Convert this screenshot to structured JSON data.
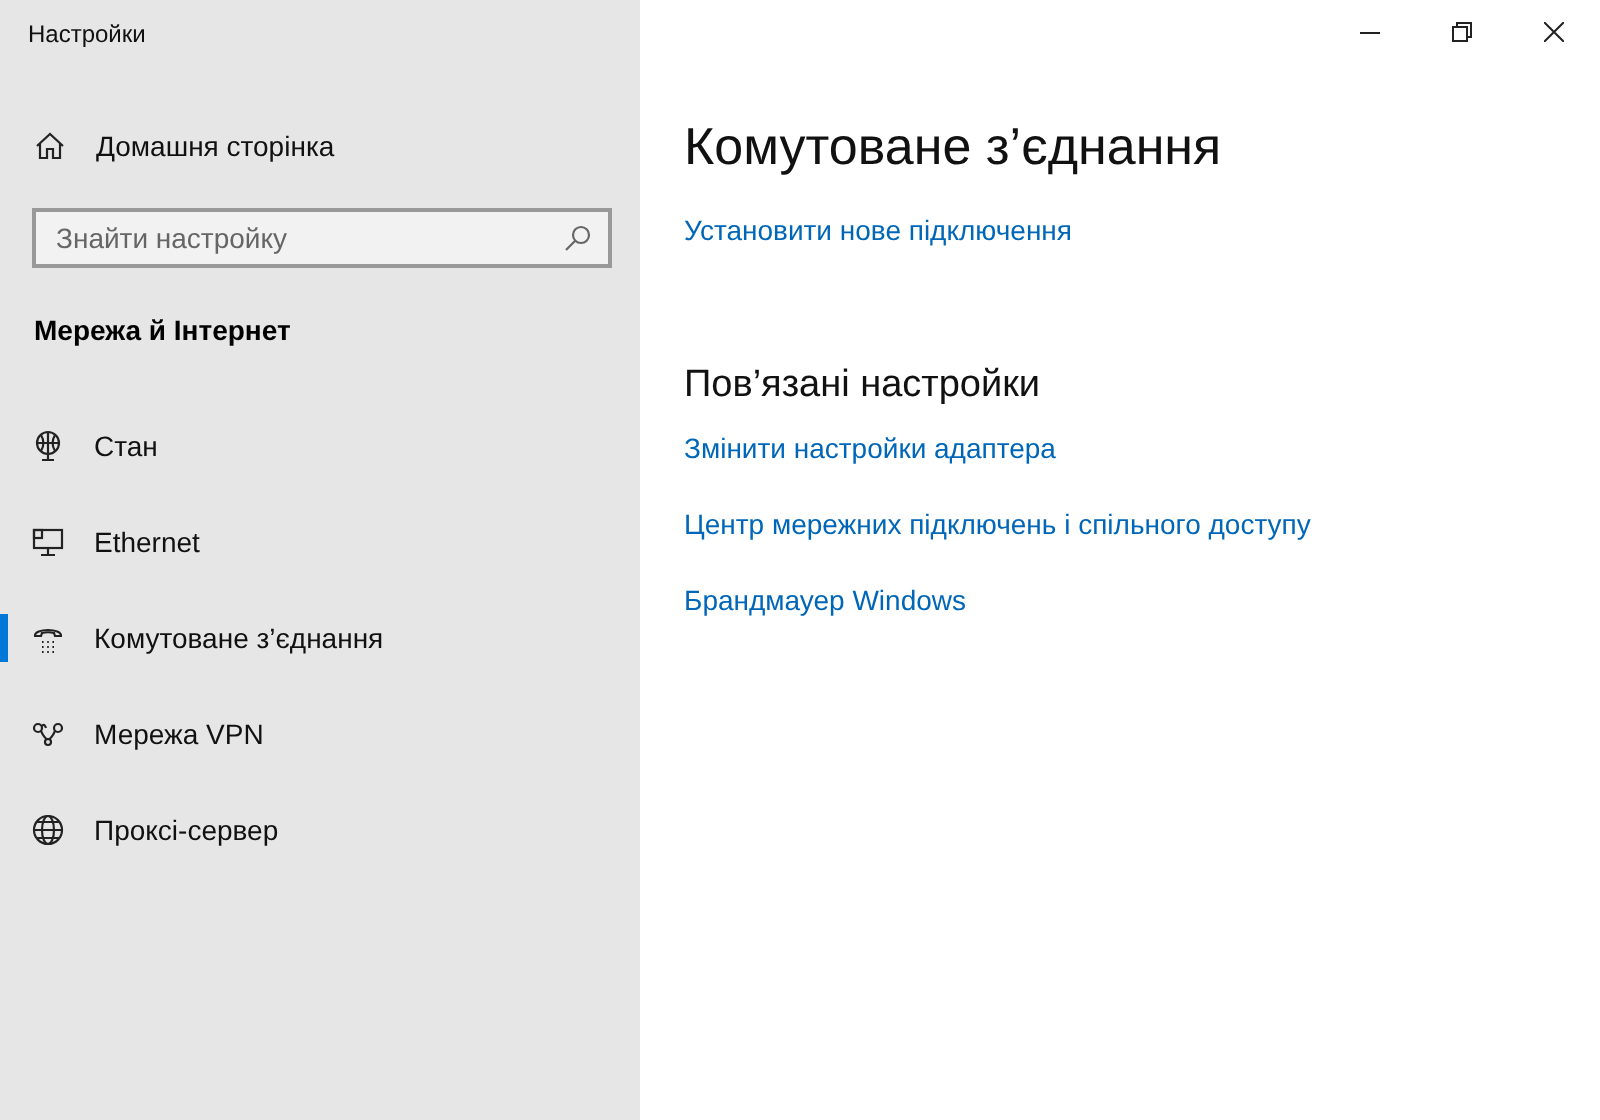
{
  "window": {
    "title": "Настройки"
  },
  "sidebar": {
    "home": "Домашня сторінка",
    "search": {
      "placeholder": "Знайти настройку"
    },
    "section": "Мережа й Інтернет",
    "items": [
      {
        "label": "Стан",
        "selected": false
      },
      {
        "label": "Ethernet",
        "selected": false
      },
      {
        "label": "Комутоване з’єднання",
        "selected": true
      },
      {
        "label": "Мережа VPN",
        "selected": false
      },
      {
        "label": "Проксі-сервер",
        "selected": false
      }
    ]
  },
  "main": {
    "title": "Комутоване з’єднання",
    "link": "Установити нове підключення",
    "related_title": "Пов’язані настройки",
    "related_links": [
      "Змінити настройки адаптера",
      "Центр мережних підключень і спільного доступу",
      "Брандмауер Windows"
    ]
  }
}
